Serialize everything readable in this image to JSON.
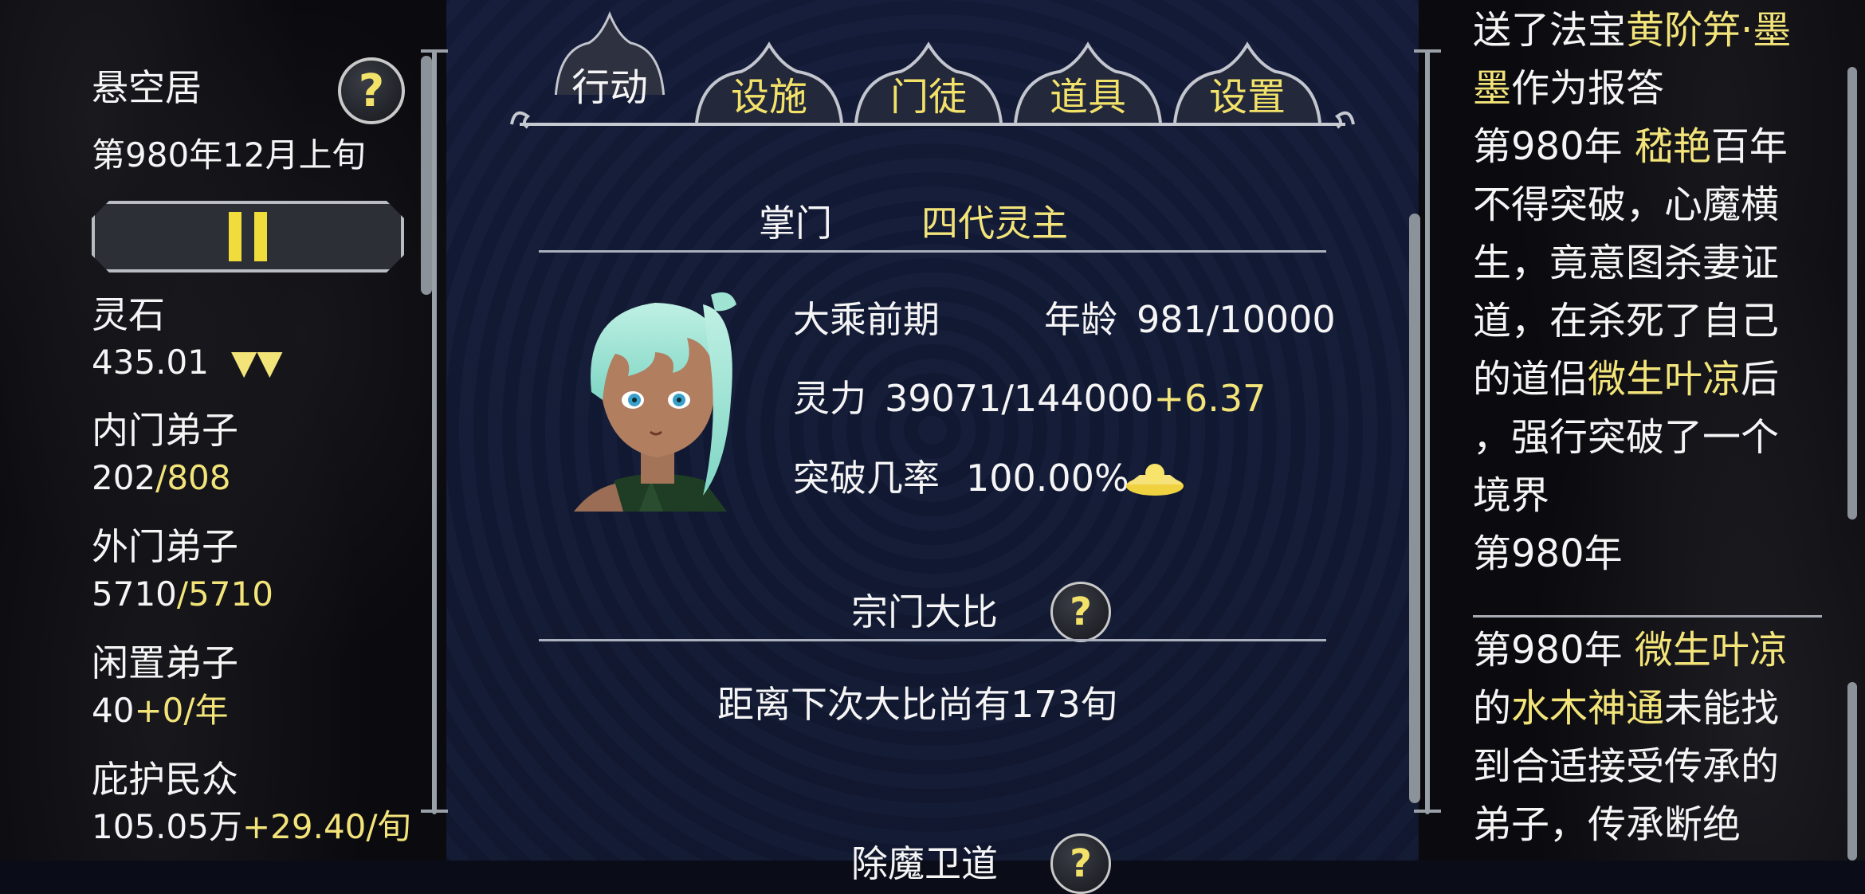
{
  "sect": {
    "name": "悬空居",
    "date": "第980年12月上旬"
  },
  "resources": [
    {
      "label": "灵石",
      "value": "435.01",
      "suffix": "",
      "indicator": "▼▼"
    },
    {
      "label": "内门弟子",
      "value": "202",
      "suffix": "/808",
      "indicator": ""
    },
    {
      "label": "外门弟子",
      "value": "5710",
      "suffix": "/5710",
      "indicator": ""
    },
    {
      "label": "闲置弟子",
      "value": "40",
      "suffix": "+0/年",
      "indicator": ""
    },
    {
      "label": "庇护民众",
      "value": "105.05万",
      "suffix": "+29.40/旬",
      "indicator": ""
    }
  ],
  "tabs": [
    {
      "label": "行动",
      "active": true
    },
    {
      "label": "设施",
      "active": false
    },
    {
      "label": "门徒",
      "active": false
    },
    {
      "label": "道具",
      "active": false
    },
    {
      "label": "设置",
      "active": false
    }
  ],
  "leader": {
    "heading": "掌门",
    "name": "四代灵主",
    "realm": "大乘前期",
    "age_label": "年龄",
    "age": "981/10000",
    "power_label": "灵力",
    "power": "39071/144000",
    "power_rate": "+6.37",
    "breakthrough_label": "突破几率",
    "breakthrough": "100.00%"
  },
  "tournament": {
    "heading": "宗门大比",
    "countdown": "距离下次大比尚有173旬"
  },
  "next_section": {
    "heading": "除魔卫道"
  },
  "log": [
    {
      "parts": [
        {
          "t": "送了法宝",
          "y": false
        },
        {
          "t": "黄阶笄·墨",
          "y": true
        }
      ]
    },
    {
      "parts": [
        {
          "t": "墨",
          "y": true
        },
        {
          "t": "作为报答",
          "y": false
        }
      ]
    },
    {
      "parts": [
        {
          "t": "第980年 ",
          "y": false
        },
        {
          "t": "嵇艳",
          "y": true
        },
        {
          "t": "百年",
          "y": false
        }
      ]
    },
    {
      "parts": [
        {
          "t": "不得突破，心魔横",
          "y": false
        }
      ]
    },
    {
      "parts": [
        {
          "t": "生，竟意图杀妻证",
          "y": false
        }
      ]
    },
    {
      "parts": [
        {
          "t": "道，在杀死了自己",
          "y": false
        }
      ]
    },
    {
      "parts": [
        {
          "t": "的道侣",
          "y": false
        },
        {
          "t": "微生叶凉",
          "y": true
        },
        {
          "t": "后",
          "y": false
        }
      ]
    },
    {
      "parts": [
        {
          "t": "，强行突破了一个",
          "y": false
        }
      ]
    },
    {
      "parts": [
        {
          "t": "境界",
          "y": false
        }
      ]
    },
    {
      "parts": [
        {
          "t": "第980年",
          "y": false
        }
      ]
    }
  ],
  "log2": [
    {
      "parts": [
        {
          "t": "第980年 ",
          "y": false
        },
        {
          "t": "微生叶凉",
          "y": true
        }
      ]
    },
    {
      "parts": [
        {
          "t": "的",
          "y": false
        },
        {
          "t": "水木神通",
          "y": true
        },
        {
          "t": "未能找",
          "y": false
        }
      ]
    },
    {
      "parts": [
        {
          "t": "到合适接受传承的",
          "y": false
        }
      ]
    },
    {
      "parts": [
        {
          "t": "弟子，传承断绝",
          "y": false
        }
      ]
    }
  ]
}
